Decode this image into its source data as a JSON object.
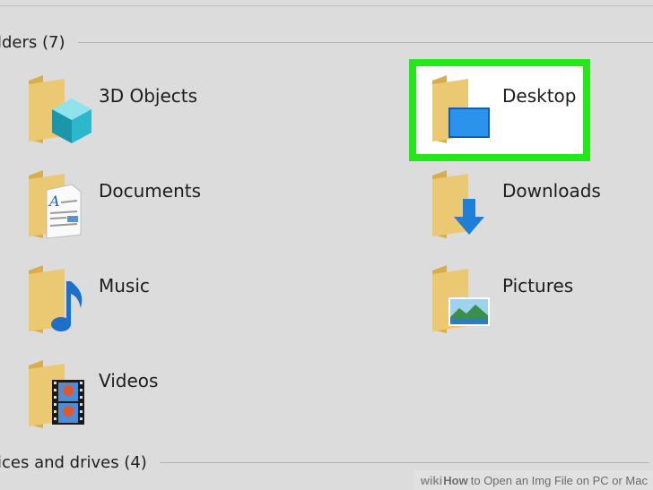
{
  "sections": {
    "folders": {
      "label": "lders (7)"
    },
    "devices": {
      "label": "ices and drives (4)"
    }
  },
  "folders": [
    {
      "label": "3D Objects",
      "icon": "3d-objects-icon"
    },
    {
      "label": "Desktop",
      "icon": "desktop-folder-icon",
      "highlighted": true
    },
    {
      "label": "Documents",
      "icon": "documents-folder-icon"
    },
    {
      "label": "Downloads",
      "icon": "downloads-folder-icon"
    },
    {
      "label": "Music",
      "icon": "music-folder-icon"
    },
    {
      "label": "Pictures",
      "icon": "pictures-folder-icon"
    },
    {
      "label": "Videos",
      "icon": "videos-folder-icon"
    }
  ],
  "watermark": {
    "brand": "wiki",
    "how": "How",
    "text": "to Open an Img File on PC or Mac"
  },
  "colors": {
    "background": "#dcdcdc",
    "highlight": "#23e61b",
    "folder": "#e8c266",
    "accent_blue": "#1e7fd8"
  }
}
